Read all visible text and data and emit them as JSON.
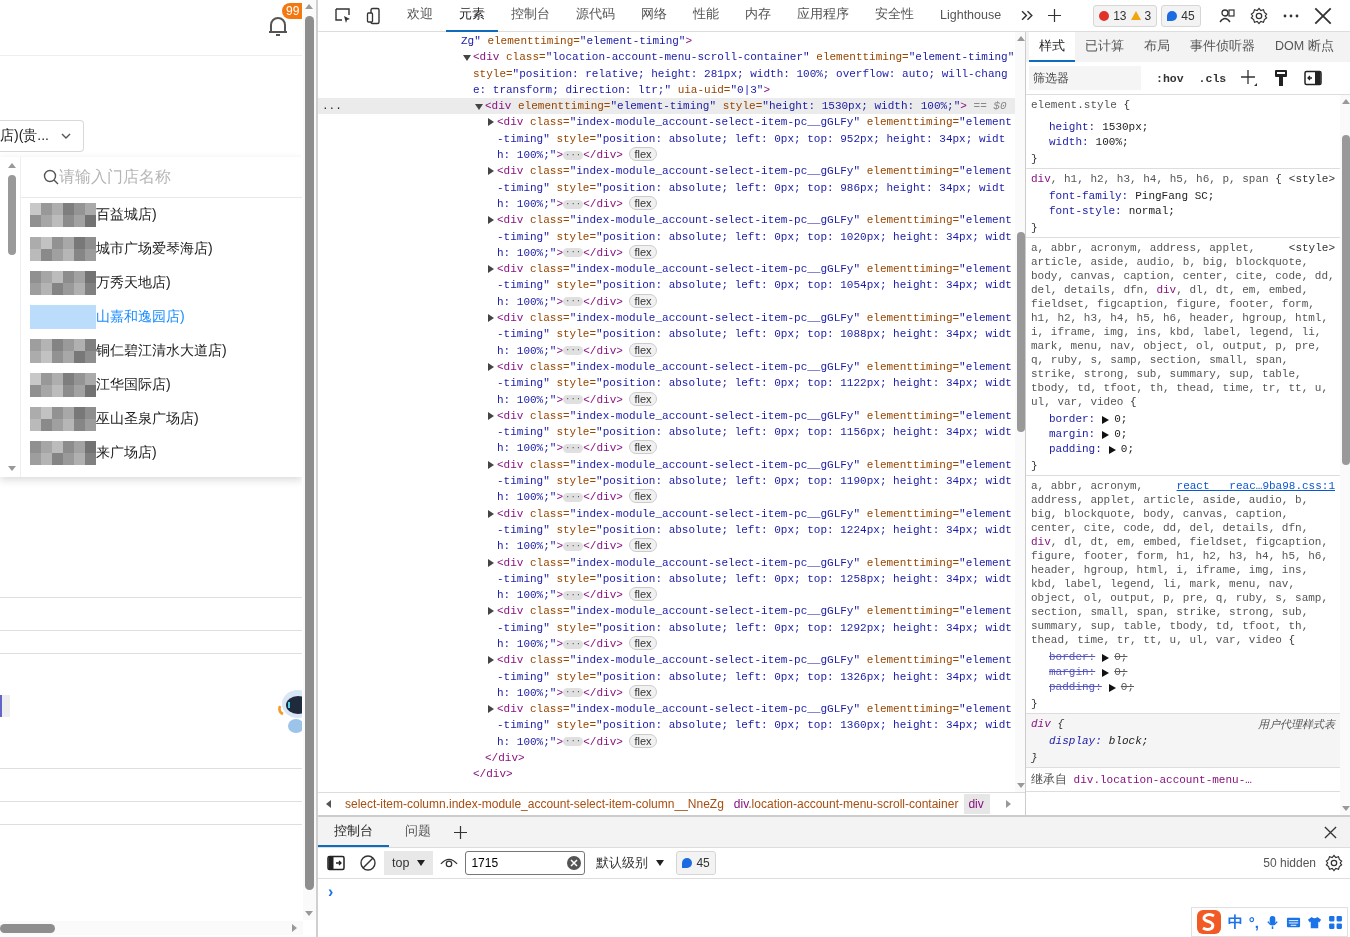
{
  "page": {
    "notification_badge": "99",
    "store_select": {
      "value": "店)(贵..."
    },
    "store_dropdown": {
      "search_placeholder": "请输入门店名称",
      "items": [
        {
          "label": "百益城店)",
          "selected": false
        },
        {
          "label": "城市广场爱琴海店)",
          "selected": false
        },
        {
          "label": "万秀天地店)",
          "selected": false
        },
        {
          "label": "山嘉和逸园店)",
          "selected": true
        },
        {
          "label": "铜仁碧江清水大道店)",
          "selected": false
        },
        {
          "label": "江华国际店)",
          "selected": false
        },
        {
          "label": "巫山圣泉广场店)",
          "selected": false
        },
        {
          "label": "来广场店)",
          "selected": false
        }
      ]
    }
  },
  "devtools": {
    "tabs": [
      {
        "label": "欢迎",
        "selected": false
      },
      {
        "label": "元素",
        "selected": true
      },
      {
        "label": "控制台",
        "selected": false
      },
      {
        "label": "源代码",
        "selected": false
      },
      {
        "label": "网络",
        "selected": false
      },
      {
        "label": "性能",
        "selected": false
      },
      {
        "label": "内存",
        "selected": false
      },
      {
        "label": "应用程序",
        "selected": false
      },
      {
        "label": "安全性",
        "selected": false
      },
      {
        "label": "Lighthouse",
        "selected": false
      }
    ],
    "counters": [
      {
        "kind": "error",
        "count": "13"
      },
      {
        "kind": "warning",
        "count": "3"
      },
      {
        "kind": "message",
        "count": "45"
      }
    ],
    "elements": {
      "gutter_mark": "...",
      "selection_suffix": "== $0",
      "collapsed_mark": "···",
      "root": {
        "attributes": [
          {
            "value": "Zg\""
          },
          {
            "name": "elementtiming=",
            "value": "\"element-timing\""
          }
        ],
        "open_end": ">",
        "children": [
          {
            "open": "<div",
            "attributes": [
              {
                "name": "class=",
                "value": "\"location-account-menu-scroll-container\""
              },
              {
                "name": "elementtiming=",
                "value": "\"element-timing\""
              },
              {
                "name": "style=",
                "value": "\"position: relative; height: 281px; width: 100%; overflow: auto; will-change: transform; direction: ltr;\""
              },
              {
                "name": "uia-uid=",
                "value": "\"0|3\""
              }
            ],
            "open_end": ">",
            "expanded": true,
            "selected": false,
            "close": "</div>",
            "children": [
              {
                "open": "<div",
                "attributes": [
                  {
                    "name": "elementtiming=",
                    "value": "\"element-timing\""
                  },
                  {
                    "name": "style=",
                    "value": "\"height: 1530px; width: 100%;\""
                  }
                ],
                "open_end": ">",
                "expanded": true,
                "selected": true,
                "close": "</div>",
                "children": [
                  {
                    "open": "<div",
                    "attributes": [
                      {
                        "name": "class=",
                        "value": "\"index-module_account-select-item-pc__gGLFy\""
                      },
                      {
                        "name": "elementtiming=",
                        "value": "\"element-timing\""
                      },
                      {
                        "name": "style=",
                        "value": "\"position: absolute; left: 0px; top: 952px; height: 34px; width: 100%;\""
                      }
                    ],
                    "open_end": ">",
                    "expanded": false,
                    "selected": false,
                    "close": "</div>",
                    "badge": "flex"
                  },
                  {
                    "open": "<div",
                    "attributes": [
                      {
                        "name": "class=",
                        "value": "\"index-module_account-select-item-pc__gGLFy\""
                      },
                      {
                        "name": "elementtiming=",
                        "value": "\"element-timing\""
                      },
                      {
                        "name": "style=",
                        "value": "\"position: absolute; left: 0px; top: 986px; height: 34px; width: 100%;\""
                      }
                    ],
                    "open_end": ">",
                    "expanded": false,
                    "selected": false,
                    "close": "</div>",
                    "badge": "flex"
                  },
                  {
                    "open": "<div",
                    "attributes": [
                      {
                        "name": "class=",
                        "value": "\"index-module_account-select-item-pc__gGLFy\""
                      },
                      {
                        "name": "elementtiming=",
                        "value": "\"element-timing\""
                      },
                      {
                        "name": "style=",
                        "value": "\"position: absolute; left: 0px; top: 1020px; height: 34px; width: 100%;\""
                      }
                    ],
                    "open_end": ">",
                    "expanded": false,
                    "selected": false,
                    "close": "</div>",
                    "badge": "flex"
                  },
                  {
                    "open": "<div",
                    "attributes": [
                      {
                        "name": "class=",
                        "value": "\"index-module_account-select-item-pc__gGLFy\""
                      },
                      {
                        "name": "elementtiming=",
                        "value": "\"element-timing\""
                      },
                      {
                        "name": "style=",
                        "value": "\"position: absolute; left: 0px; top: 1054px; height: 34px; width: 100%;\""
                      }
                    ],
                    "open_end": ">",
                    "expanded": false,
                    "selected": false,
                    "close": "</div>",
                    "badge": "flex"
                  },
                  {
                    "open": "<div",
                    "attributes": [
                      {
                        "name": "class=",
                        "value": "\"index-module_account-select-item-pc__gGLFy\""
                      },
                      {
                        "name": "elementtiming=",
                        "value": "\"element-timing\""
                      },
                      {
                        "name": "style=",
                        "value": "\"position: absolute; left: 0px; top: 1088px; height: 34px; width: 100%;\""
                      }
                    ],
                    "open_end": ">",
                    "expanded": false,
                    "selected": false,
                    "close": "</div>",
                    "badge": "flex"
                  },
                  {
                    "open": "<div",
                    "attributes": [
                      {
                        "name": "class=",
                        "value": "\"index-module_account-select-item-pc__gGLFy\""
                      },
                      {
                        "name": "elementtiming=",
                        "value": "\"element-timing\""
                      },
                      {
                        "name": "style=",
                        "value": "\"position: absolute; left: 0px; top: 1122px; height: 34px; width: 100%;\""
                      }
                    ],
                    "open_end": ">",
                    "expanded": false,
                    "selected": false,
                    "close": "</div>",
                    "badge": "flex"
                  },
                  {
                    "open": "<div",
                    "attributes": [
                      {
                        "name": "class=",
                        "value": "\"index-module_account-select-item-pc__gGLFy\""
                      },
                      {
                        "name": "elementtiming=",
                        "value": "\"element-timing\""
                      },
                      {
                        "name": "style=",
                        "value": "\"position: absolute; left: 0px; top: 1156px; height: 34px; width: 100%;\""
                      }
                    ],
                    "open_end": ">",
                    "expanded": false,
                    "selected": false,
                    "close": "</div>",
                    "badge": "flex"
                  },
                  {
                    "open": "<div",
                    "attributes": [
                      {
                        "name": "class=",
                        "value": "\"index-module_account-select-item-pc__gGLFy\""
                      },
                      {
                        "name": "elementtiming=",
                        "value": "\"element-timing\""
                      },
                      {
                        "name": "style=",
                        "value": "\"position: absolute; left: 0px; top: 1190px; height: 34px; width: 100%;\""
                      }
                    ],
                    "open_end": ">",
                    "expanded": false,
                    "selected": false,
                    "close": "</div>",
                    "badge": "flex"
                  },
                  {
                    "open": "<div",
                    "attributes": [
                      {
                        "name": "class=",
                        "value": "\"index-module_account-select-item-pc__gGLFy\""
                      },
                      {
                        "name": "elementtiming=",
                        "value": "\"element-timing\""
                      },
                      {
                        "name": "style=",
                        "value": "\"position: absolute; left: 0px; top: 1224px; height: 34px; width: 100%;\""
                      }
                    ],
                    "open_end": ">",
                    "expanded": false,
                    "selected": false,
                    "close": "</div>",
                    "badge": "flex"
                  },
                  {
                    "open": "<div",
                    "attributes": [
                      {
                        "name": "class=",
                        "value": "\"index-module_account-select-item-pc__gGLFy\""
                      },
                      {
                        "name": "elementtiming=",
                        "value": "\"element-timing\""
                      },
                      {
                        "name": "style=",
                        "value": "\"position: absolute; left: 0px; top: 1258px; height: 34px; width: 100%;\""
                      }
                    ],
                    "open_end": ">",
                    "expanded": false,
                    "selected": false,
                    "close": "</div>",
                    "badge": "flex"
                  },
                  {
                    "open": "<div",
                    "attributes": [
                      {
                        "name": "class=",
                        "value": "\"index-module_account-select-item-pc__gGLFy\""
                      },
                      {
                        "name": "elementtiming=",
                        "value": "\"element-timing\""
                      },
                      {
                        "name": "style=",
                        "value": "\"position: absolute; left: 0px; top: 1292px; height: 34px; width: 100%;\""
                      }
                    ],
                    "open_end": ">",
                    "expanded": false,
                    "selected": false,
                    "close": "</div>",
                    "badge": "flex"
                  },
                  {
                    "open": "<div",
                    "attributes": [
                      {
                        "name": "class=",
                        "value": "\"index-module_account-select-item-pc__gGLFy\""
                      },
                      {
                        "name": "elementtiming=",
                        "value": "\"element-timing\""
                      },
                      {
                        "name": "style=",
                        "value": "\"position: absolute; left: 0px; top: 1326px; height: 34px; width: 100%;\""
                      }
                    ],
                    "open_end": ">",
                    "expanded": false,
                    "selected": false,
                    "close": "</div>",
                    "badge": "flex"
                  },
                  {
                    "open": "<div",
                    "attributes": [
                      {
                        "name": "class=",
                        "value": "\"index-module_account-select-item-pc__gGLFy\""
                      },
                      {
                        "name": "elementtiming=",
                        "value": "\"element-timing\""
                      },
                      {
                        "name": "style=",
                        "value": "\"position: absolute; left: 0px; top: 1360px; height: 34px; width: 100%;\""
                      }
                    ],
                    "open_end": ">",
                    "expanded": false,
                    "selected": false,
                    "close": "</div>",
                    "badge": "flex"
                  }
                ]
              }
            ]
          }
        ]
      }
    },
    "breadcrumbs": [
      {
        "classes": "select-item-column.index-module_account-select-item-column__NneZg",
        "selected": false
      },
      {
        "tag": "div",
        "classes": ".location-account-menu-scroll-container",
        "selected": false
      },
      {
        "tag": "div",
        "selected": true
      }
    ],
    "styles": {
      "tabs": [
        {
          "label": "样式",
          "selected": true
        },
        {
          "label": "已计算",
          "selected": false
        },
        {
          "label": "布局",
          "selected": false
        },
        {
          "label": "事件侦听器",
          "selected": false
        },
        {
          "label": "DOM 断点",
          "selected": false
        }
      ],
      "filter_placeholder": "筛选器",
      "toggles": [
        ":hov",
        ".cls"
      ],
      "rules": [
        {
          "selector": [
            {
              "text": "element.style",
              "matched": false
            }
          ],
          "brace": "{",
          "user_agent": false,
          "properties": [
            {
              "name": "height:",
              "value": "1530px;",
              "overridden": false,
              "expandable": false
            },
            {
              "name": "width:",
              "value": "100%;",
              "overridden": false,
              "expandable": false
            }
          ],
          "close": "}"
        },
        {
          "selector": [
            {
              "text": "div",
              "matched": true
            },
            {
              "text": ", h1, h2, h3, h4, h5, h6, p, span",
              "matched": false
            }
          ],
          "source": {
            "text": "<style>",
            "link": false
          },
          "brace": "{",
          "user_agent": false,
          "properties": [
            {
              "name": "font-family:",
              "value": "PingFang SC;",
              "overridden": false,
              "expandable": false
            },
            {
              "name": "font-style:",
              "value": "normal;",
              "overridden": false,
              "expandable": false
            }
          ],
          "close": "}"
        },
        {
          "selector": [
            {
              "text": "a, abbr, acronym, address, applet, ",
              "matched": false
            },
            {
              "text": "article, aside, audio, b, big, blockquote, body, canvas, caption, center, cite, code, dd, del, details, dfn, ",
              "matched": false
            },
            {
              "text": "div",
              "matched": true
            },
            {
              "text": ", dl, dt, em, embed, fieldset, figcaption, figure, footer, form, h1, h2, h3, h4, h5, h6, header, hgroup, html, i, iframe, img, ins, kbd, label, legend, li, mark, menu, nav, object, ol, output, p, pre, q, ruby, s, samp, section, small, span, strike, strong, sub, summary, sup, table, tbody, td, tfoot, th, thead, time, tr, tt, u, ul, var, video",
              "matched": false
            }
          ],
          "source": {
            "text": "<style>",
            "link": false
          },
          "brace": "{",
          "user_agent": false,
          "properties": [
            {
              "name": "border:",
              "value": "0;",
              "overridden": false,
              "expandable": true
            },
            {
              "name": "margin:",
              "value": "0;",
              "overridden": false,
              "expandable": true
            },
            {
              "name": "padding:",
              "value": "0;",
              "overridden": false,
              "expandable": true
            }
          ],
          "close": "}"
        },
        {
          "selector": [
            {
              "text": "a, abbr, acronym, ",
              "matched": false
            },
            {
              "text": "address, applet, article, aside, audio, b, big, blockquote, body, canvas, caption, center, cite, code, dd, del, details, dfn, ",
              "matched": false
            },
            {
              "text": "div",
              "matched": true
            },
            {
              "text": ", dl, dt, em, embed, fieldset, figcaption, figure, footer, form, h1, h2, h3, h4, h5, h6, header, hgroup, html, i, iframe, img, ins, kbd, label, legend, li, mark, menu, nav, object, ol, output, p, pre, q, ruby, s, samp, section, small, span, strike, strong, sub, summary, sup, table, tbody, td, tfoot, th, thead, time, tr, tt, u, ul, var, video",
              "matched": false
            }
          ],
          "source": {
            "text": "react   reac…9ba98.css:1",
            "link": true
          },
          "brace": "{",
          "user_agent": false,
          "properties": [
            {
              "name": "border:",
              "value": "0;",
              "overridden": true,
              "expandable": true
            },
            {
              "name": "margin:",
              "value": "0;",
              "overridden": true,
              "expandable": true
            },
            {
              "name": "padding:",
              "value": "0;",
              "overridden": true,
              "expandable": true
            }
          ],
          "close": "}"
        },
        {
          "selector": [
            {
              "text": "div",
              "matched": true
            }
          ],
          "source": {
            "text": "用户代理样式表",
            "link": false
          },
          "brace": "{",
          "user_agent": true,
          "properties": [
            {
              "name": "display:",
              "value": "block;",
              "overridden": false,
              "expandable": false
            }
          ],
          "close": "}"
        }
      ],
      "inherited": {
        "label": "继承自",
        "selector": "div.location-account-menu-…"
      }
    },
    "drawer": {
      "tabs": [
        {
          "label": "控制台",
          "selected": true
        },
        {
          "label": "问题",
          "selected": false
        }
      ],
      "context": "top",
      "filter_value": "1715",
      "level": "默认级别",
      "message_count": "45",
      "hidden_count": "50 hidden",
      "prompt": "›"
    }
  },
  "ime_toolbar": {
    "mode": "中",
    "punctuation": "°,"
  }
}
